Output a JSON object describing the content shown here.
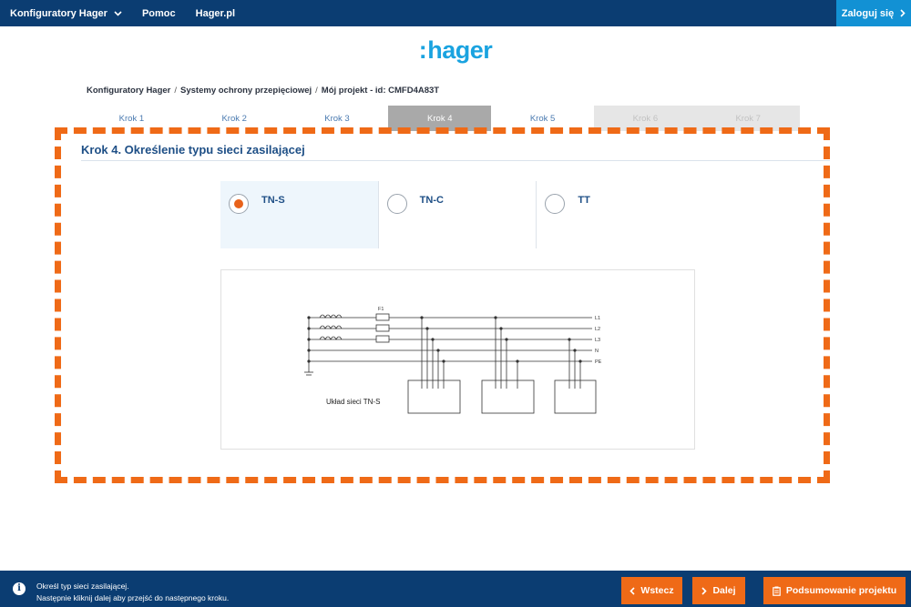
{
  "nav": {
    "configurators": "Konfiguratory Hager",
    "help": "Pomoc",
    "site": "Hager.pl",
    "login": "Zaloguj się"
  },
  "logo": {
    "text": "hager",
    "mark": ":"
  },
  "breadcrumb": {
    "items": [
      "Konfiguratory Hager",
      "Systemy ochrony przepięciowej",
      "Mój projekt - id: CMFD4A83T"
    ],
    "separator": "/"
  },
  "steps": [
    {
      "label": "Krok 1",
      "state": "default"
    },
    {
      "label": "Krok 2",
      "state": "default"
    },
    {
      "label": "Krok 3",
      "state": "default"
    },
    {
      "label": "Krok 4",
      "state": "active"
    },
    {
      "label": "Krok 5",
      "state": "default"
    },
    {
      "label": "Krok 6",
      "state": "disabled"
    },
    {
      "label": "Krok 7",
      "state": "disabled"
    }
  ],
  "main": {
    "title": "Krok 4. Określenie typu sieci zasilającej",
    "options": [
      {
        "label": "TN-S",
        "selected": true
      },
      {
        "label": "TN-C",
        "selected": false
      },
      {
        "label": "TT",
        "selected": false
      }
    ],
    "diagram": {
      "caption": "Układ sieci TN-S",
      "fuse_label": "F1",
      "line_labels": [
        "L1",
        "L2",
        "L3",
        "N",
        "PE"
      ]
    }
  },
  "footer": {
    "info_line1": "Określ typ sieci zasilającej.",
    "info_line2": "Następnie kliknij dalej aby przejść do następnego kroku.",
    "back": "Wstecz",
    "next": "Dalej",
    "summary": "Podsumowanie projektu"
  },
  "colors": {
    "nav_bg": "#0b3d72",
    "accent": "#ef6a17",
    "login_bg": "#1291d4",
    "logo": "#1aa3e0",
    "title": "#1e4f86"
  }
}
